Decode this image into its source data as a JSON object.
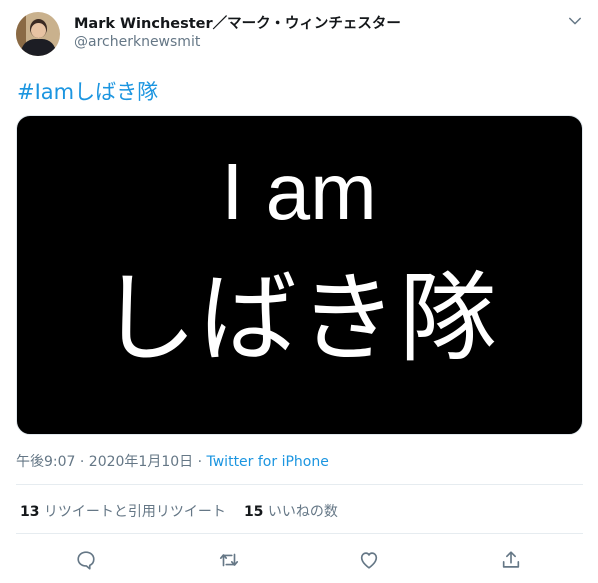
{
  "author": {
    "display_name": "Mark Winchester／マーク・ウィンチェスター",
    "handle": "@archerknewsmit"
  },
  "tweet": {
    "hashtag": "#Iamしばき隊",
    "media": {
      "line1": "I am",
      "line2": "しばき隊"
    },
    "timestamp": "午後9:07 · 2020年1月10日 · ",
    "source": "Twitter for iPhone"
  },
  "stats": {
    "retweets_count": "13",
    "retweets_label": " リツイートと引用リツイート",
    "likes_count": "15",
    "likes_label": " いいねの数"
  },
  "icons": {
    "reply": "reply-icon",
    "retweet": "retweet-icon",
    "like": "heart-icon",
    "share": "share-icon",
    "caret": "chevron-down-icon"
  },
  "colors": {
    "accent": "#1b95e0",
    "secondary_text": "#657786",
    "media_bg": "#000000"
  }
}
